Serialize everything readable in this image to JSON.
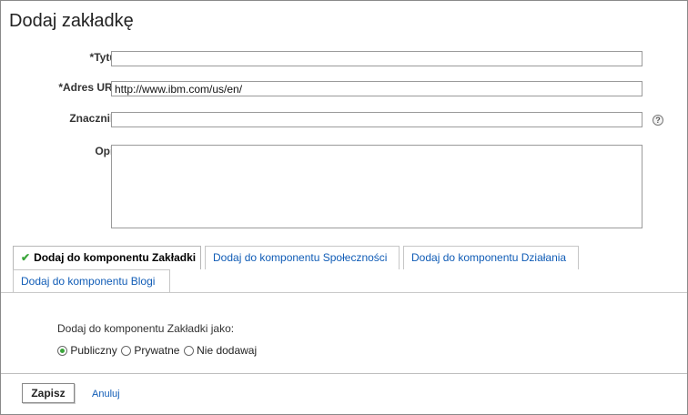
{
  "dialog": {
    "title": "Dodaj zakładkę"
  },
  "form": {
    "title_label": "*Tytuł:",
    "title_value": "",
    "url_label": "*Adres URL:",
    "url_value": "http://www.ibm.com/us/en/",
    "tags_label": "Znaczniki:",
    "tags_value": "",
    "tags_help": "?",
    "desc_label": "Opis:",
    "desc_value": ""
  },
  "tabs": [
    {
      "label": "Dodaj do komponentu Zakładki",
      "active": true,
      "check": "✔"
    },
    {
      "label": "Dodaj do komponentu Społeczności",
      "active": false
    },
    {
      "label": "Dodaj do komponentu Działania",
      "active": false
    },
    {
      "label": "Dodaj do komponentu Blogi",
      "active": false
    }
  ],
  "visibility": {
    "prompt": "Dodaj do komponentu Zakładki jako:",
    "options": [
      "Publiczny",
      "Prywatne",
      "Nie dodawaj"
    ],
    "selected": "Publiczny"
  },
  "footer": {
    "save_label": "Zapisz",
    "cancel_label": "Anuluj"
  },
  "colors": {
    "link": "#105cb6",
    "check": "#3aa53a"
  }
}
